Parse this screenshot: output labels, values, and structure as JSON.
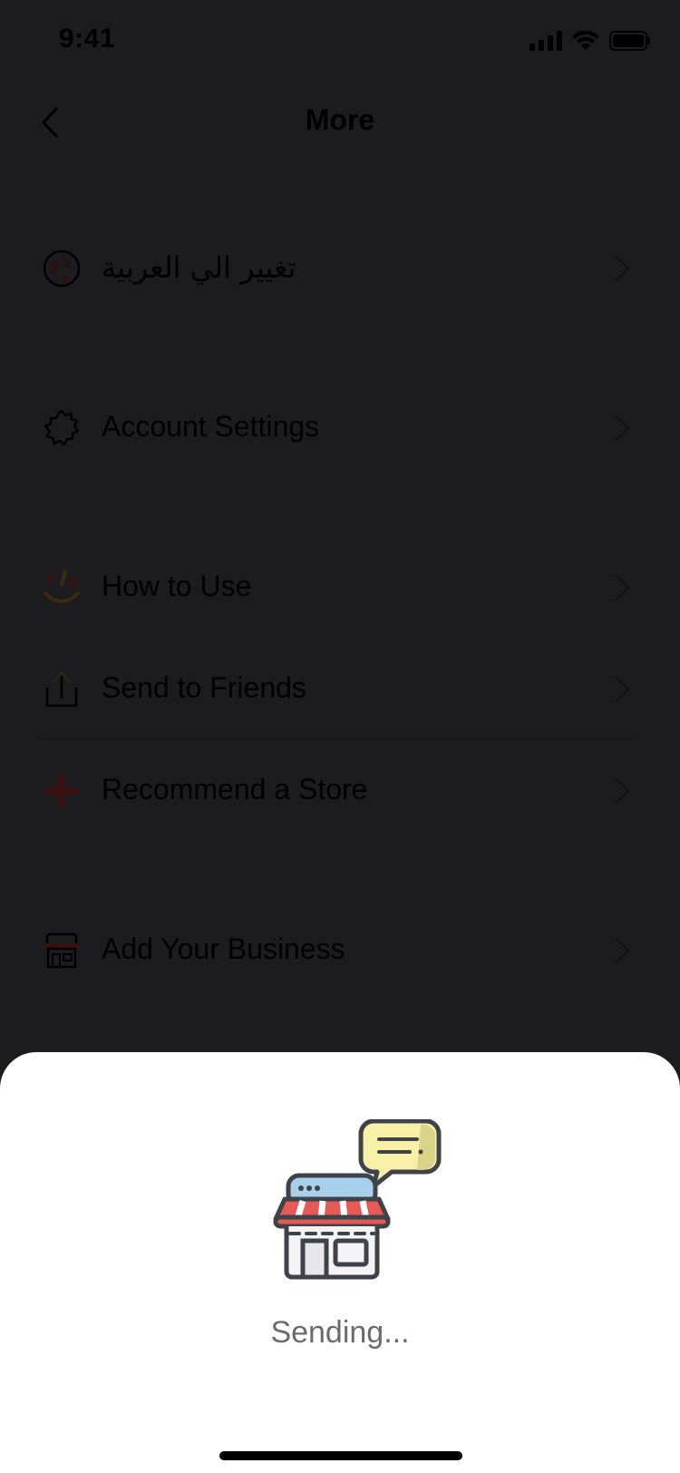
{
  "status_bar": {
    "time": "9:41"
  },
  "nav": {
    "title": "More"
  },
  "menu": {
    "items": [
      {
        "label": "تغيير الي العربية",
        "icon": "globe-icon"
      },
      {
        "label": "Account Settings",
        "icon": "gear-icon"
      },
      {
        "label": "How to Use",
        "icon": "smile-icon"
      },
      {
        "label": "Send to Friends",
        "icon": "share-icon"
      },
      {
        "label": "Recommend a Store",
        "icon": "plus-icon"
      },
      {
        "label": "Add Your Business",
        "icon": "store-icon"
      }
    ]
  },
  "sheet": {
    "status_text": "Sending..."
  },
  "colors": {
    "overlay_bg": "#1c1c1e",
    "sheet_bg": "#ffffff",
    "awning_red": "#e55a55",
    "bubble_yellow": "#f8f0a6",
    "store_blue": "#a9d0ea"
  }
}
